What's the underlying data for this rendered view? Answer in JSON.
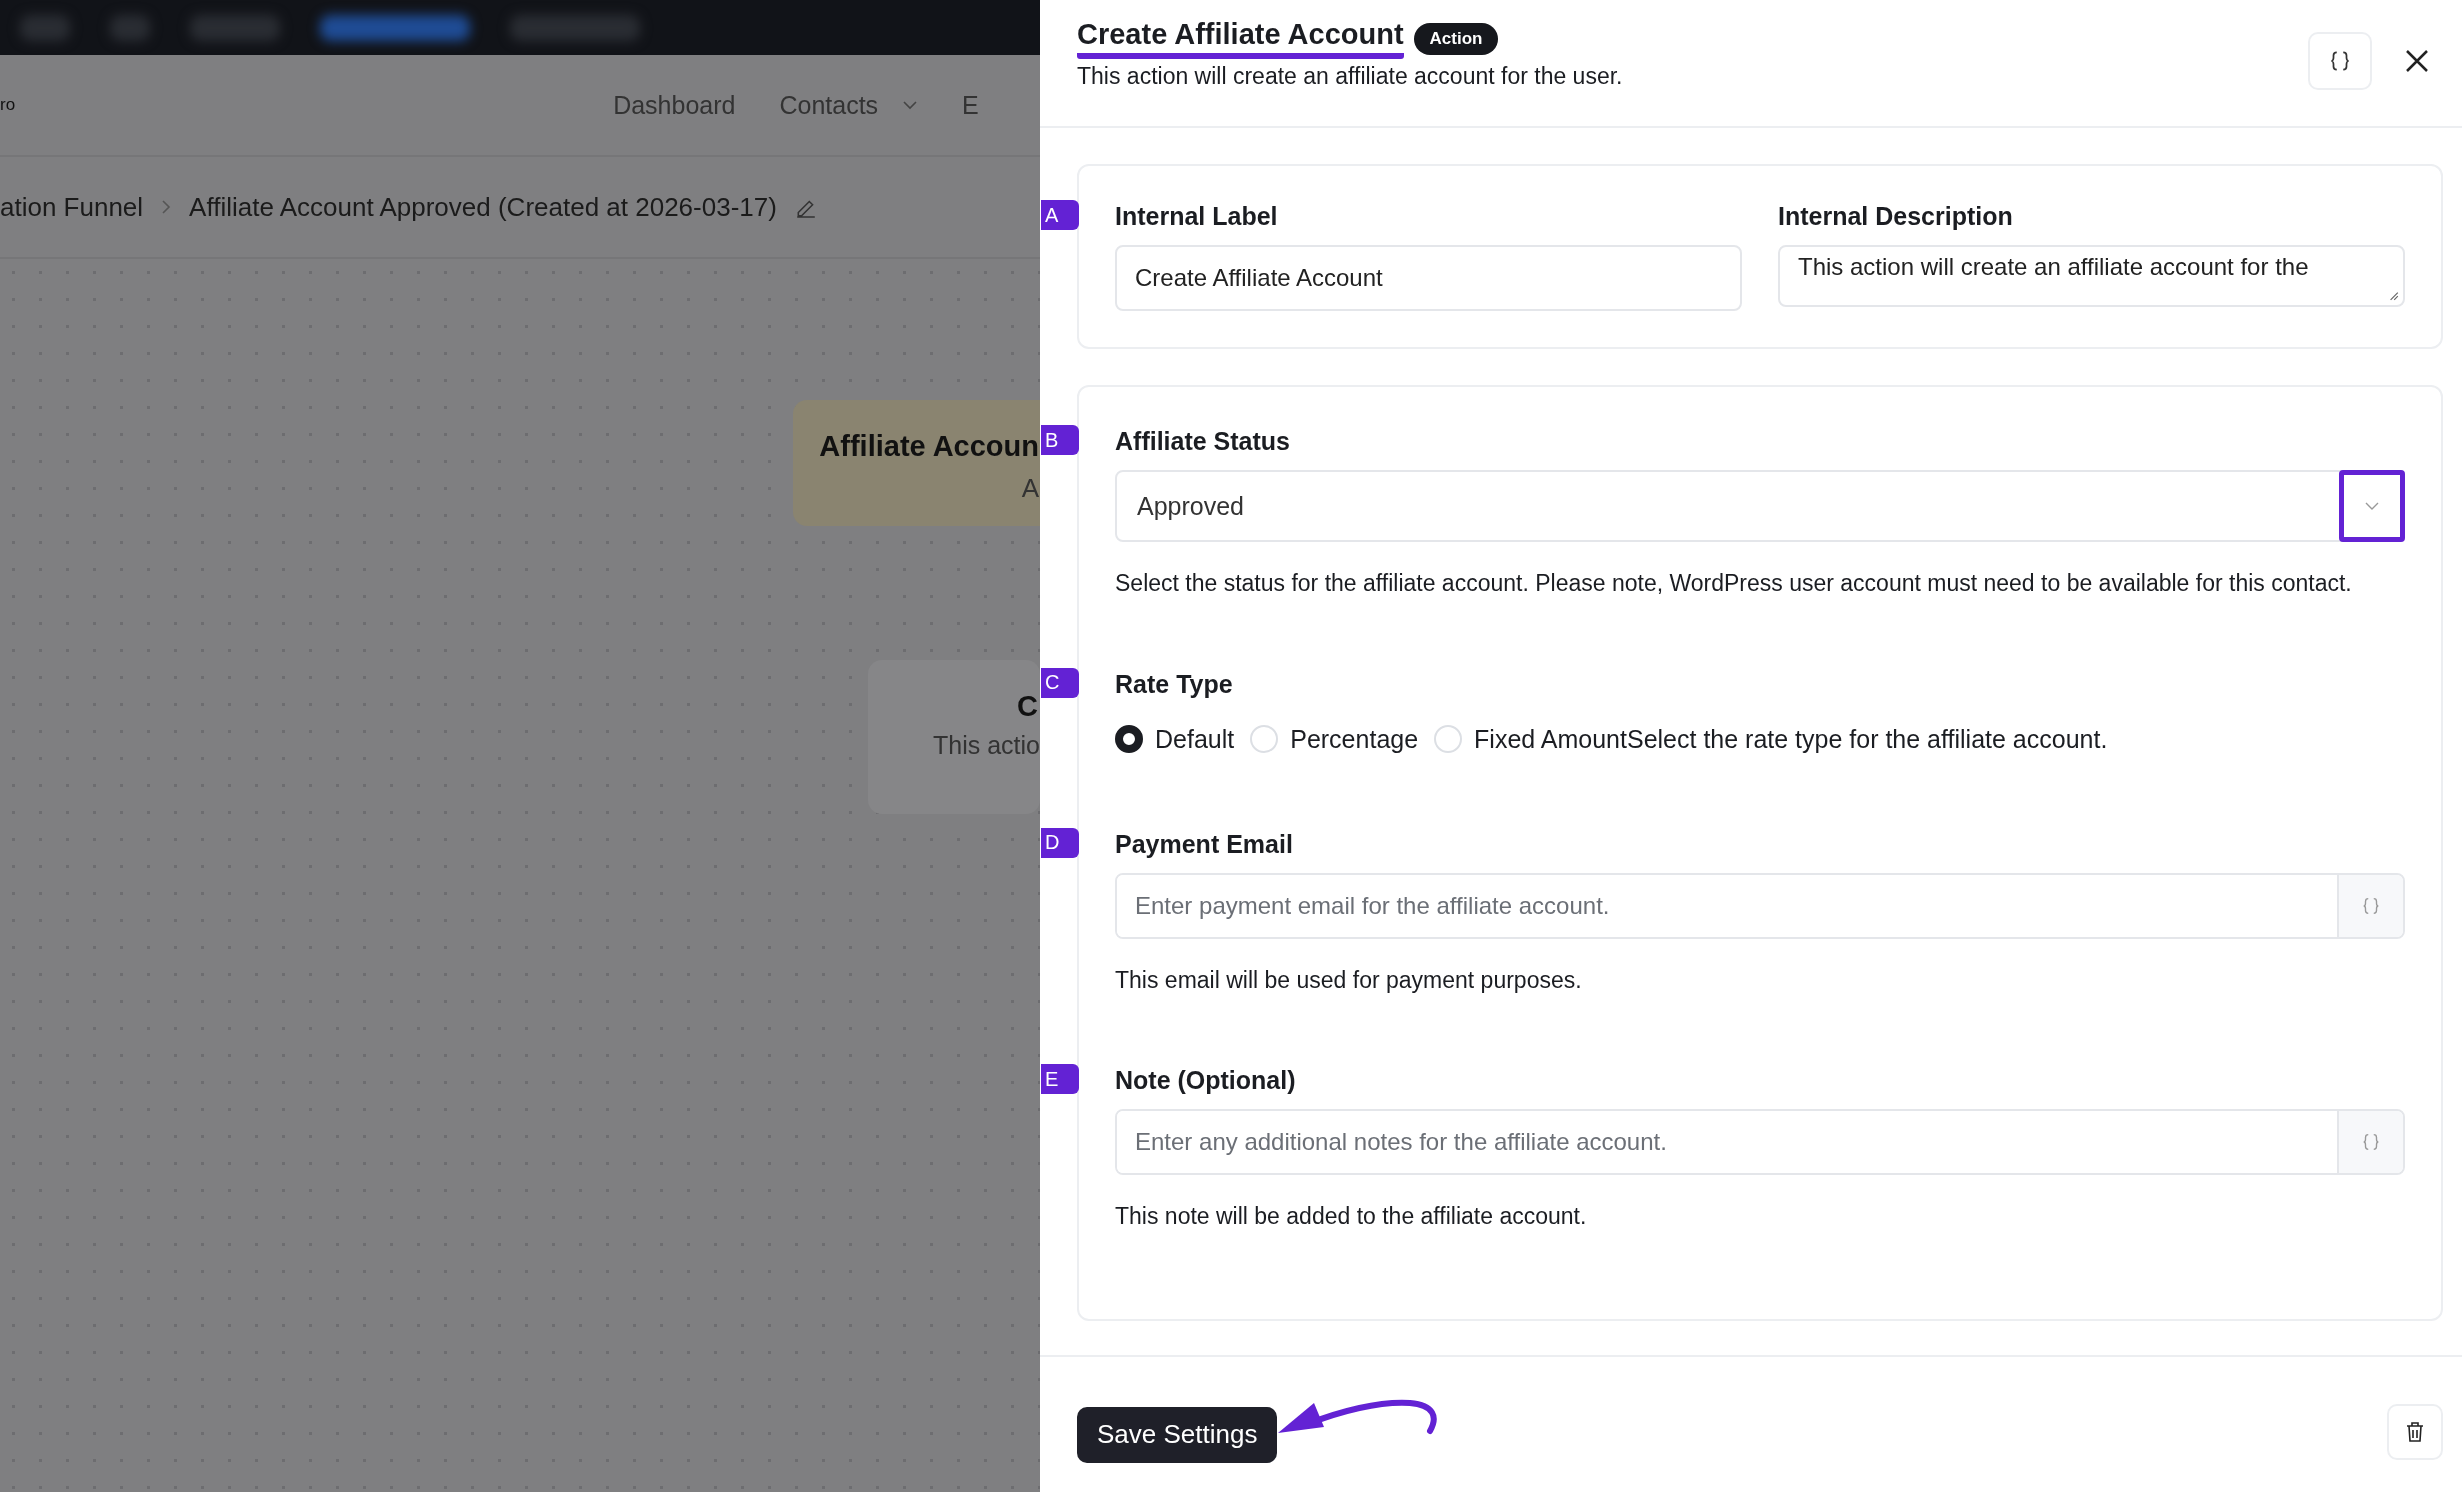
{
  "background": {
    "brand_fragment": "ro",
    "nav_items": [
      {
        "label": "Dashboard",
        "has_caret": false
      },
      {
        "label": "Contacts",
        "has_caret": true
      },
      {
        "label": "E",
        "has_caret": false
      }
    ],
    "breadcrumb": [
      "ation Funnel",
      "Affiliate Account Approved (Created at 2026-03-17)"
    ],
    "canvas_nodes": [
      {
        "kind": "trigger",
        "title": "Affiliate Accoun",
        "subtitle": "A"
      },
      {
        "kind": "action",
        "title": "C",
        "subtitle": "This actio"
      }
    ]
  },
  "drawer": {
    "title": "Create Affiliate Account",
    "badge": "Action",
    "description": "This action will create an affiliate account for the user.",
    "cards": [
      {
        "fields": [
          {
            "kind": "text",
            "marker": "A",
            "label": "Internal Label",
            "value": "Create Affiliate Account"
          },
          {
            "kind": "textarea",
            "label": "Internal Description",
            "value": "This action will create an affiliate account for the"
          }
        ]
      },
      {
        "fields": [
          {
            "kind": "select",
            "marker": "B",
            "label": "Affiliate Status",
            "value": "Approved",
            "help": "Select the status for the affiliate account. Please note, WordPress user account must need to be available for this contact."
          },
          {
            "kind": "radio",
            "marker": "C",
            "label": "Rate Type",
            "options": [
              {
                "label": "Default",
                "selected": true
              },
              {
                "label": "Percentage",
                "selected": false
              },
              {
                "label": "Fixed Amount",
                "selected": false
              }
            ],
            "help": "Select the rate type for the affiliate account."
          },
          {
            "kind": "input_addon",
            "marker": "D",
            "label": "Payment Email",
            "placeholder": "Enter payment email for the affiliate account.",
            "help": "This email will be used for payment purposes."
          },
          {
            "kind": "input_addon",
            "marker": "E",
            "label": "Note (Optional)",
            "placeholder": "Enter any additional notes for the affiliate account.",
            "help": "This note will be added to the affiliate account."
          }
        ]
      }
    ],
    "save_button": "Save Settings"
  }
}
